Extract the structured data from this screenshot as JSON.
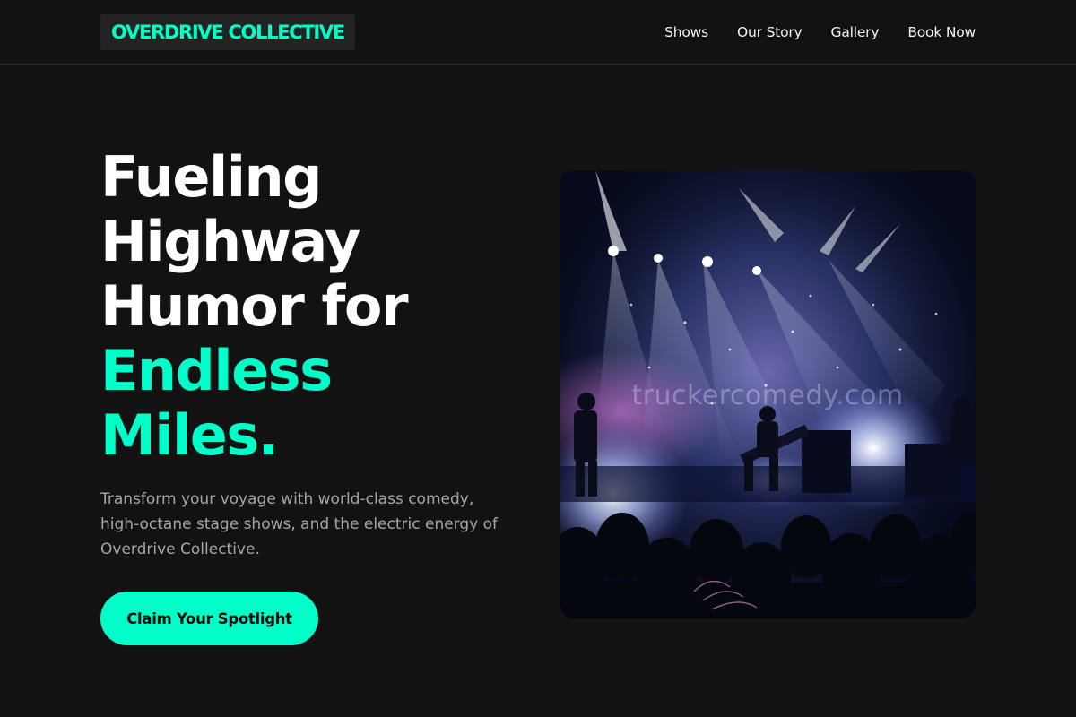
{
  "header": {
    "logo_text": "OVERDRIVE COLLECTIVE",
    "nav": [
      {
        "label": "Shows"
      },
      {
        "label": "Our Story"
      },
      {
        "label": "Gallery"
      },
      {
        "label": "Book Now"
      }
    ]
  },
  "hero": {
    "title_lines": [
      "Fueling",
      "Highway",
      "Humor for"
    ],
    "title_accent_lines": [
      "Endless",
      "Miles."
    ],
    "subtitle_lines": [
      "Transform your voyage with world-class comedy,",
      "high-octane stage shows, and the electric energy of",
      "Overdrive Collective."
    ],
    "cta_label": "Claim Your Spotlight",
    "image": {
      "icon": "concert-stage-photo",
      "watermark": "truckercomedy.com"
    }
  },
  "colors": {
    "background": "#121212",
    "accent": "#00ffc8",
    "text": "#ffffff",
    "muted_text": "#a6a6a6",
    "logo_bg": "#232323"
  }
}
